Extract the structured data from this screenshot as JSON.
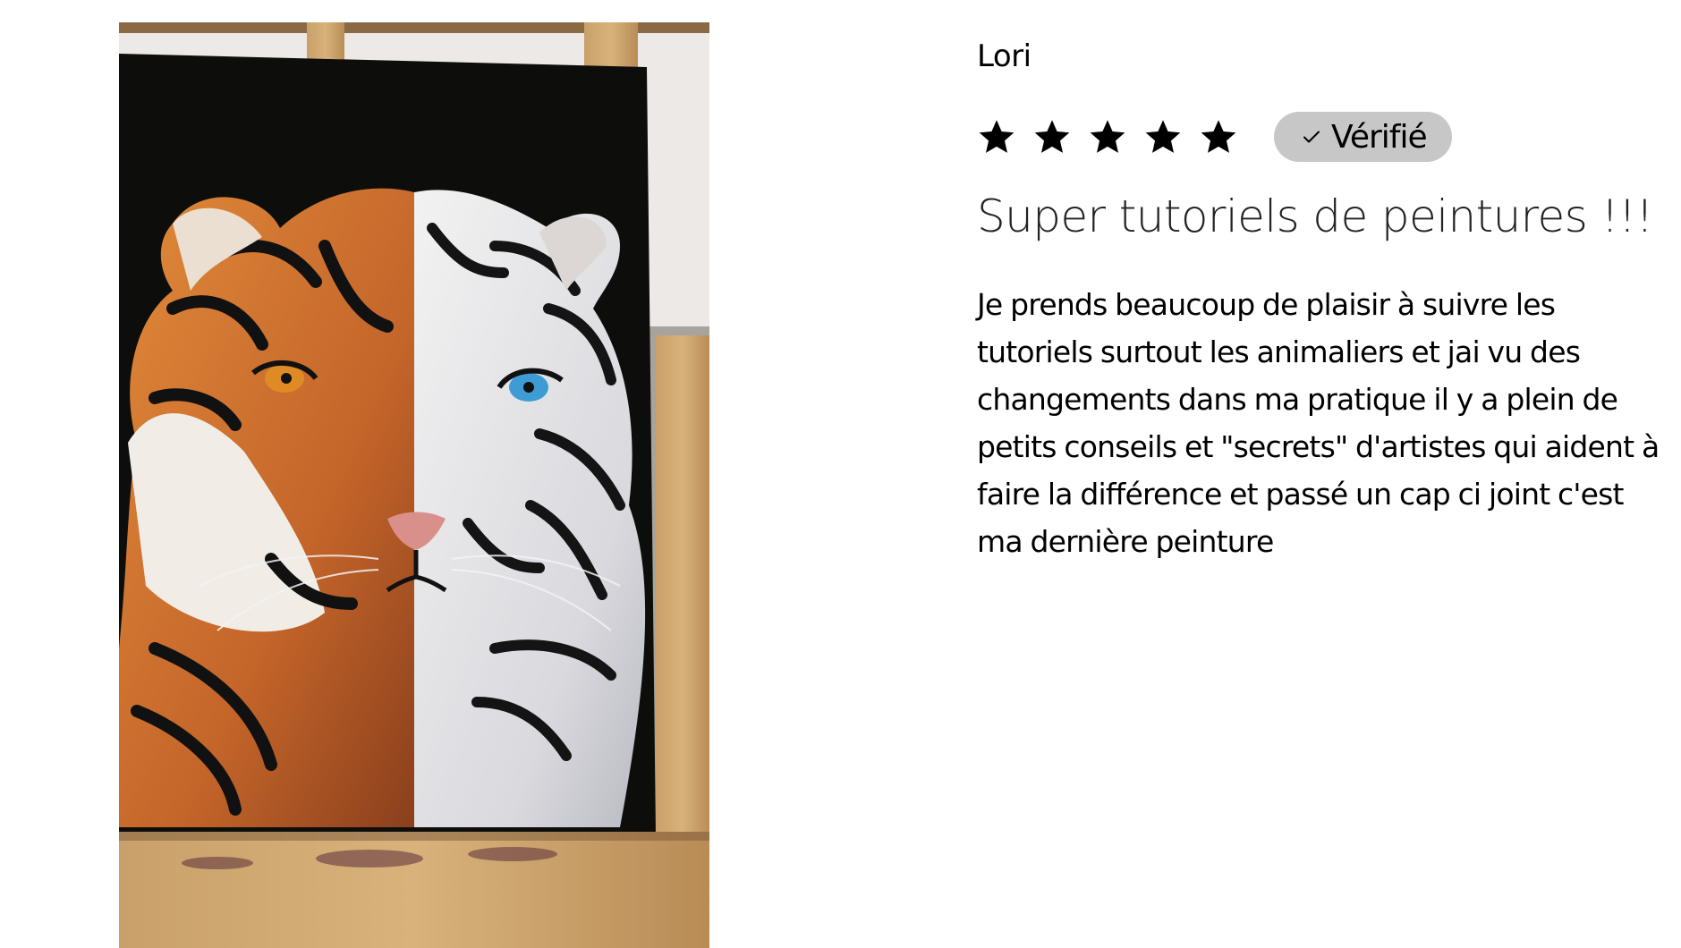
{
  "review": {
    "author": "Lori",
    "rating": 5,
    "rating_max": 5,
    "verified_label": "Vérifié",
    "title": "Super tutoriels de peintures !!!",
    "body": "Je prends beaucoup de plaisir à suivre les tutoriels surtout les animaliers et jai vu des changements dans ma pratique il y a plein de petits conseils et \"secrets\" d'artistes qui aident à faire la différence et passé un cap ci joint c'est ma dernière peinture"
  },
  "colors": {
    "star": "#000000",
    "badge_bg": "#c7c7c7",
    "text": "#000000"
  },
  "icons": {
    "star": "star-icon",
    "check": "check-icon"
  }
}
